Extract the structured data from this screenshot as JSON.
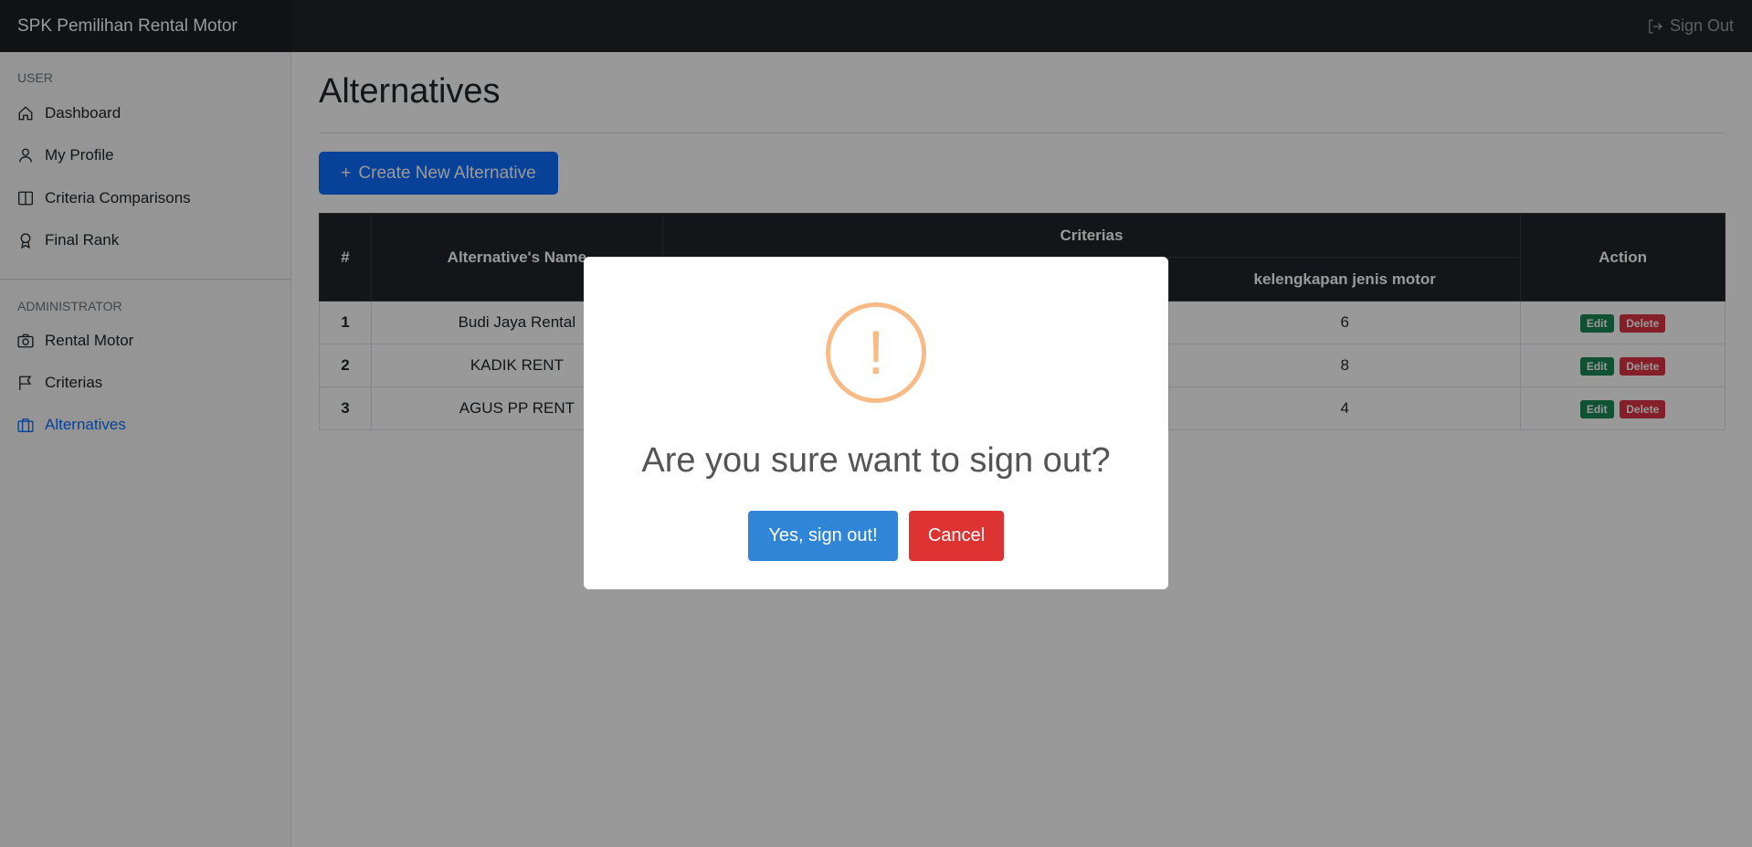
{
  "app": {
    "brand": "SPK Pemilihan Rental Motor",
    "sign_out": "Sign Out"
  },
  "sidebar": {
    "user_heading": "USER",
    "user_items": [
      {
        "label": "Dashboard",
        "icon": "home-icon"
      },
      {
        "label": "My Profile",
        "icon": "user-icon"
      },
      {
        "label": "Criteria Comparisons",
        "icon": "columns-icon"
      },
      {
        "label": "Final Rank",
        "icon": "award-icon"
      }
    ],
    "admin_heading": "ADMINISTRATOR",
    "admin_items": [
      {
        "label": "Rental Motor",
        "icon": "camera-icon"
      },
      {
        "label": "Criterias",
        "icon": "flag-icon"
      },
      {
        "label": "Alternatives",
        "icon": "briefcase-icon",
        "active": true
      }
    ]
  },
  "main": {
    "title": "Alternatives",
    "create_button": "Create New Alternative",
    "table": {
      "col_num": "#",
      "col_name": "Alternative's Name",
      "col_criterias": "Criterias",
      "col_criteria_1": "kelengkapan jenis motor",
      "col_action": "Action",
      "rows": [
        {
          "num": "1",
          "name": "Budi Jaya Rental",
          "value": "6"
        },
        {
          "num": "2",
          "name": "KADIK RENT",
          "value": "8"
        },
        {
          "num": "3",
          "name": "AGUS PP RENT",
          "value": "4"
        }
      ],
      "edit_label": "Edit",
      "delete_label": "Delete"
    }
  },
  "modal": {
    "icon": "warning-icon",
    "icon_mark": "!",
    "title": "Are you sure want to sign out?",
    "confirm": "Yes, sign out!",
    "cancel": "Cancel",
    "colors": {
      "warning": "#f8bb86",
      "confirm": "#3085d6",
      "cancel": "#dd3333"
    }
  }
}
